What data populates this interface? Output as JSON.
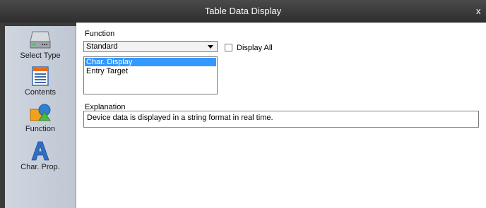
{
  "window": {
    "title": "Table Data Display",
    "close_glyph": "x"
  },
  "sidebar": {
    "items": [
      {
        "label": "Select Type",
        "icon": "hard-drive-icon"
      },
      {
        "label": "Contents",
        "icon": "table-list-icon"
      },
      {
        "label": "Function",
        "icon": "shapes-icon"
      },
      {
        "label": "Char. Prop.",
        "icon": "letter-a-icon"
      }
    ],
    "selected": "Function"
  },
  "function": {
    "label": "Function",
    "selected_value": "Standard",
    "display_all_label": "Display All",
    "display_all_checked": false,
    "list_items": [
      "Char. Display",
      "Entry Target"
    ],
    "list_selected_index": 0
  },
  "explanation": {
    "label": "Explanation",
    "text": "Device data is displayed in a string format in real time."
  },
  "colors": {
    "selection": "#3399ff",
    "titlebar": "#3a3a3a",
    "sidebar": "#c8cfda"
  }
}
